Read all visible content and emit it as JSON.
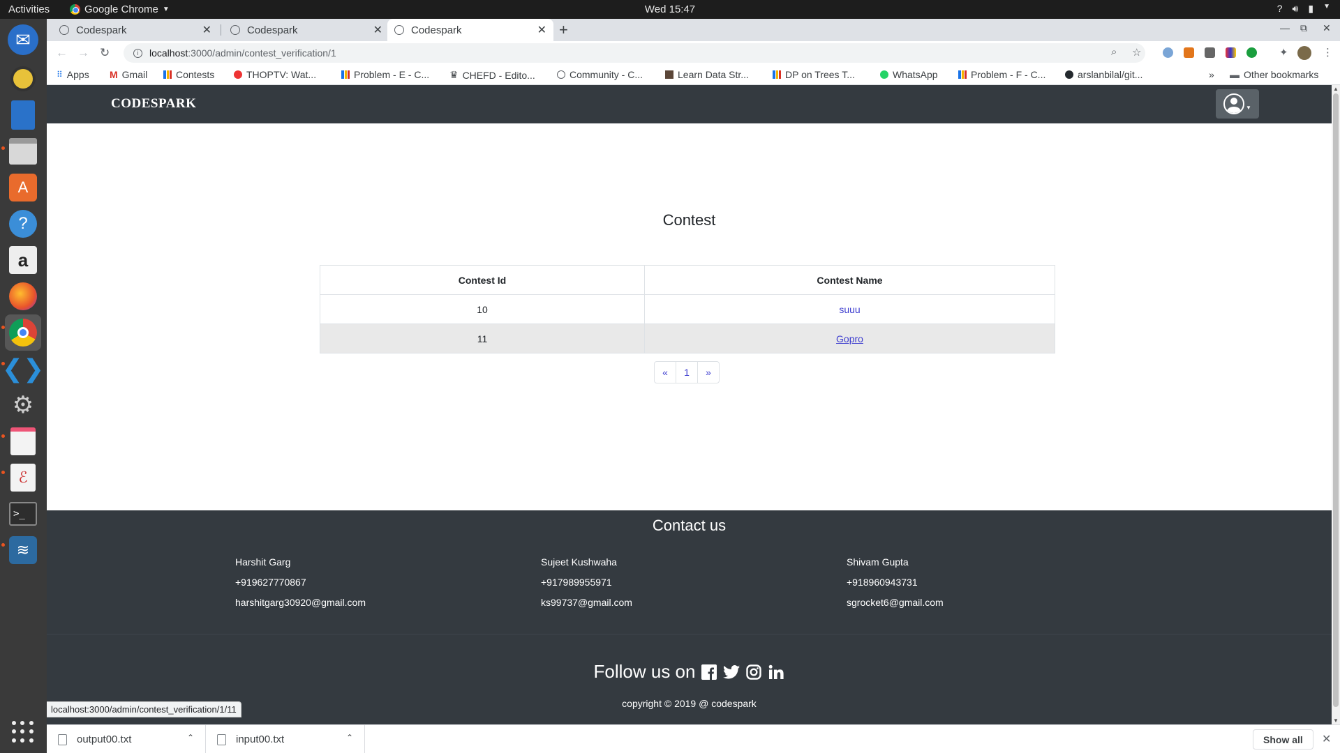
{
  "system": {
    "activities": "Activities",
    "app_name": "Google Chrome",
    "clock": "Wed 15:47"
  },
  "browser": {
    "tabs": [
      {
        "title": "Codespark"
      },
      {
        "title": "Codespark"
      },
      {
        "title": "Codespark"
      }
    ],
    "address": {
      "host": "localhost",
      "path": ":3000/admin/contest_verification/1"
    },
    "bookmarks": [
      {
        "label": "Apps"
      },
      {
        "label": "Gmail"
      },
      {
        "label": "Contests"
      },
      {
        "label": "THOPTV: Wat..."
      },
      {
        "label": "Problem - E - C..."
      },
      {
        "label": "CHEFD - Edito..."
      },
      {
        "label": "Community - C..."
      },
      {
        "label": "Learn Data Str..."
      },
      {
        "label": "DP on Trees T..."
      },
      {
        "label": "WhatsApp"
      },
      {
        "label": "Problem - F - C..."
      },
      {
        "label": "arslanbilal/git..."
      }
    ],
    "other_bookmarks": "Other bookmarks",
    "status_url": "localhost:3000/admin/contest_verification/1/11",
    "downloads": [
      {
        "name": "output00.txt"
      },
      {
        "name": "input00.txt"
      }
    ],
    "show_all": "Show all"
  },
  "site": {
    "brand": "CODESPARK",
    "page_title": "Contest",
    "table": {
      "headers": [
        "Contest Id",
        "Contest Name"
      ],
      "rows": [
        {
          "id": "10",
          "name": "suuu"
        },
        {
          "id": "11",
          "name": "Gopro"
        }
      ]
    },
    "pagination": {
      "prev": "«",
      "page": "1",
      "next": "»"
    },
    "footer": {
      "contact_title": "Contact us",
      "contacts": [
        {
          "name": "Harshit Garg",
          "phone": "+919627770867",
          "email": "harshitgarg30920@gmail.com"
        },
        {
          "name": "Sujeet Kushwaha",
          "phone": "+917989955971",
          "email": "ks99737@gmail.com"
        },
        {
          "name": "Shivam Gupta",
          "phone": "+918960943731",
          "email": "sgrocket6@gmail.com"
        }
      ],
      "follow": "Follow us on",
      "copyright": "copyright © 2019 @ codespark"
    }
  }
}
